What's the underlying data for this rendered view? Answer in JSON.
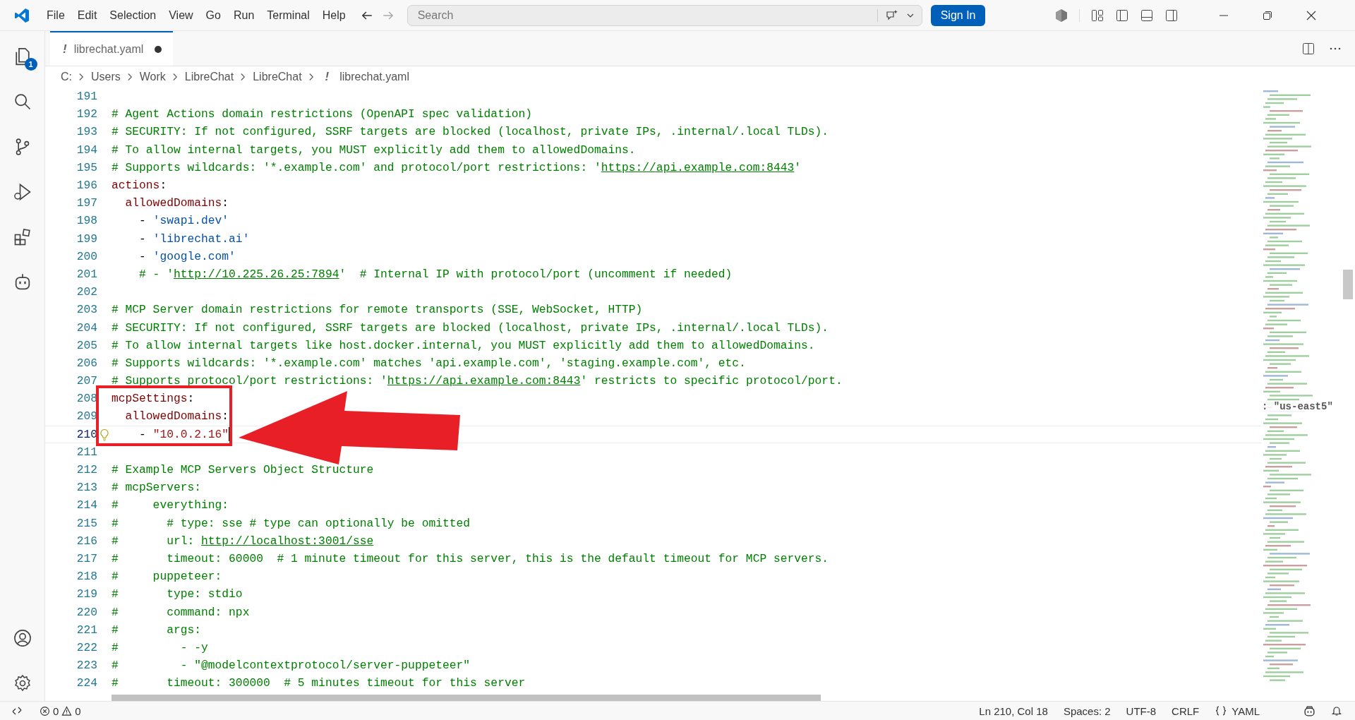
{
  "menu": [
    "File",
    "Edit",
    "Selection",
    "View",
    "Go",
    "Run",
    "Terminal",
    "Help"
  ],
  "search": {
    "placeholder": "Search"
  },
  "sign_in": "Sign In",
  "activity_bar": {
    "explorer_badge": "1"
  },
  "tabs": [
    {
      "icon": "!",
      "label": "librechat.yaml",
      "dirty": true,
      "selected": true
    }
  ],
  "breadcrumb": {
    "parts": [
      "C:",
      "Users",
      "Work",
      "LibreChat",
      "LibreChat"
    ],
    "file_icon": "!",
    "file": "librechat.yaml"
  },
  "lines": [
    {
      "number": "191"
    },
    {
      "number": "192",
      "tokens": [
        {
          "kind": "comment",
          "text": "# Agent Actions domain restrictions (OpenAPI spec validation)"
        }
      ]
    },
    {
      "number": "193",
      "tokens": [
        {
          "kind": "comment",
          "text": "# SECURITY: If not configured, SSRF targets are blocked (localhost, private IPs, .internal/.local TLDs)."
        }
      ]
    },
    {
      "number": "194",
      "tokens": [
        {
          "kind": "comment",
          "text": "# To allow internal targets, you MUST explicitly add them to allowedDomains."
        }
      ]
    },
    {
      "number": "195",
      "tokens": [
        {
          "kind": "comment",
          "text": "# Supports wildcards: '*.example.com' and protocol/port restrictions: '"
        },
        {
          "kind": "link",
          "text": "https://api.example.com:8443"
        },
        {
          "kind": "comment",
          "text": "'"
        }
      ]
    },
    {
      "number": "196",
      "tokens": [
        {
          "kind": "key",
          "text": "actions"
        },
        {
          "kind": "plain",
          "text": ":"
        }
      ]
    },
    {
      "number": "197",
      "tokens": [
        {
          "kind": "key",
          "text": "  allowedDomains"
        },
        {
          "kind": "plain",
          "text": ":"
        }
      ]
    },
    {
      "number": "198",
      "tokens": [
        {
          "kind": "plain",
          "text": "    - "
        },
        {
          "kind": "string",
          "text": "'swapi.dev'"
        }
      ]
    },
    {
      "number": "199",
      "tokens": [
        {
          "kind": "plain",
          "text": "    - "
        },
        {
          "kind": "string",
          "text": "'librechat.ai'"
        }
      ]
    },
    {
      "number": "200",
      "tokens": [
        {
          "kind": "plain",
          "text": "    - "
        },
        {
          "kind": "string",
          "text": "'google.com'"
        }
      ]
    },
    {
      "number": "201",
      "tokens": [
        {
          "kind": "comment",
          "text": "    # - '"
        },
        {
          "kind": "link",
          "text": "http://10.225.26.25:7894"
        },
        {
          "kind": "comment",
          "text": "'  # Internal IP with protocol/port (uncomment if needed)"
        }
      ]
    },
    {
      "number": "202"
    },
    {
      "number": "203",
      "tokens": [
        {
          "kind": "comment",
          "text": "# MCP Server domain restrictions for remote transports (SSE, WebSocket, HTTP)"
        }
      ]
    },
    {
      "number": "204",
      "tokens": [
        {
          "kind": "comment",
          "text": "# SECURITY: If not configured, SSRF targets are blocked (localhost, private IPs, .internal/.local TLDs)."
        }
      ]
    },
    {
      "number": "205",
      "tokens": [
        {
          "kind": "comment",
          "text": "# To allow internal targets like host.docker.internal, you MUST explicitly add them to allowedDomains."
        }
      ]
    },
    {
      "number": "206",
      "tokens": [
        {
          "kind": "comment",
          "text": "# Supports wildcards: '*.example.com' matches 'api.example.com', 'staging.example.com', etc."
        }
      ]
    },
    {
      "number": "207",
      "tokens": [
        {
          "kind": "comment",
          "text": "# Supports protocol/port restrictions: '"
        },
        {
          "kind": "link",
          "text": "https://api.example.com:8443"
        },
        {
          "kind": "comment",
          "text": "' restricts to specific protocol/port."
        }
      ]
    },
    {
      "number": "208",
      "boxed": true,
      "tokens": [
        {
          "kind": "key",
          "text": "mcpSettings"
        },
        {
          "kind": "plain",
          "text": ":"
        }
      ]
    },
    {
      "number": "209",
      "boxed": true,
      "tokens": [
        {
          "kind": "key",
          "text": "  allowedDomains"
        },
        {
          "kind": "plain",
          "text": ":"
        }
      ]
    },
    {
      "number": "210",
      "boxed": true,
      "current": true,
      "lightbulb": true,
      "tokens": [
        {
          "kind": "plain",
          "text": "    - "
        },
        {
          "kind": "quoted",
          "text": "\"10.0.2.16\""
        }
      ]
    },
    {
      "number": "211"
    },
    {
      "number": "212",
      "tokens": [
        {
          "kind": "comment",
          "text": "# Example MCP Servers Object Structure"
        }
      ]
    },
    {
      "number": "213",
      "tokens": [
        {
          "kind": "comment",
          "text": "# mcpServers:"
        }
      ]
    },
    {
      "number": "214",
      "tokens": [
        {
          "kind": "comment",
          "text": "#     everything:"
        }
      ]
    },
    {
      "number": "215",
      "tokens": [
        {
          "kind": "comment",
          "text": "#       # type: sse # type can optionally be omitted"
        }
      ]
    },
    {
      "number": "216",
      "tokens": [
        {
          "kind": "comment",
          "text": "#       url: "
        },
        {
          "kind": "link",
          "text": "http://localhost:3001/sse"
        }
      ]
    },
    {
      "number": "217",
      "tokens": [
        {
          "kind": "comment",
          "text": "#       timeout: 60000  # 1 minute timeout for this server, this is the default timeout for MCP servers."
        }
      ]
    },
    {
      "number": "218",
      "tokens": [
        {
          "kind": "comment",
          "text": "#     puppeteer:"
        }
      ]
    },
    {
      "number": "219",
      "tokens": [
        {
          "kind": "comment",
          "text": "#       type: stdio"
        }
      ]
    },
    {
      "number": "220",
      "tokens": [
        {
          "kind": "comment",
          "text": "#       command: npx"
        }
      ]
    },
    {
      "number": "221",
      "tokens": [
        {
          "kind": "comment",
          "text": "#       args:"
        }
      ]
    },
    {
      "number": "222",
      "tokens": [
        {
          "kind": "comment",
          "text": "#         - -y"
        }
      ]
    },
    {
      "number": "223",
      "tokens": [
        {
          "kind": "comment",
          "text": "#         - \"@modelcontextprotocol/server-puppeteer\""
        }
      ]
    },
    {
      "number": "224",
      "tokens": [
        {
          "kind": "comment",
          "text": "#       timeout: 300000  # 5 minutes timeout for this server"
        }
      ]
    }
  ],
  "minimap": {
    "hover_text": ": \"us-east5\""
  },
  "status_bar": {
    "errors": "0",
    "warnings": "0",
    "position": "Ln 210, Col 18",
    "indent": "Spaces: 2",
    "encoding": "UTF-8",
    "eol": "CRLF",
    "language": "YAML"
  }
}
